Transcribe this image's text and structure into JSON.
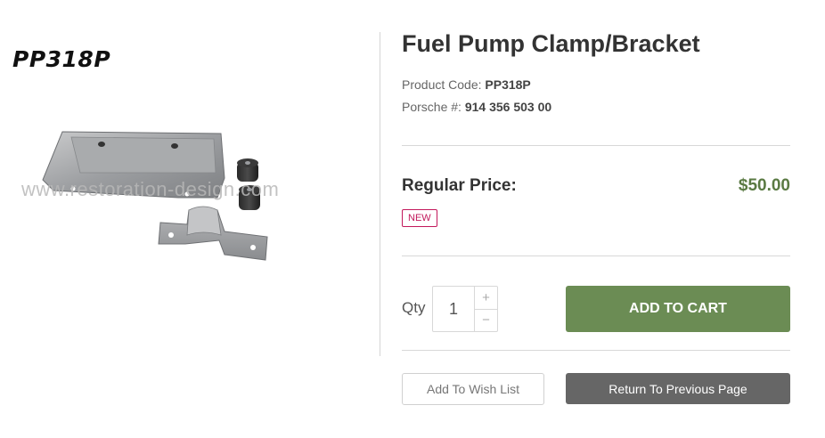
{
  "product": {
    "label": "PP318P",
    "watermark": "www.restoration-design.com",
    "title": "Fuel Pump Clamp/Bracket",
    "code_label": "Product Code:",
    "code_value": "PP318P",
    "porsche_label": "Porsche #:",
    "porsche_value": "914 356 503 00"
  },
  "pricing": {
    "label": "Regular Price:",
    "value": "$50.00",
    "badge": "NEW"
  },
  "cart": {
    "qty_label": "Qty",
    "qty_value": "1",
    "increment": "+",
    "decrement": "−",
    "add_label": "ADD TO CART"
  },
  "actions": {
    "wishlist_label": "Add To Wish List",
    "return_label": "Return To Previous Page"
  }
}
